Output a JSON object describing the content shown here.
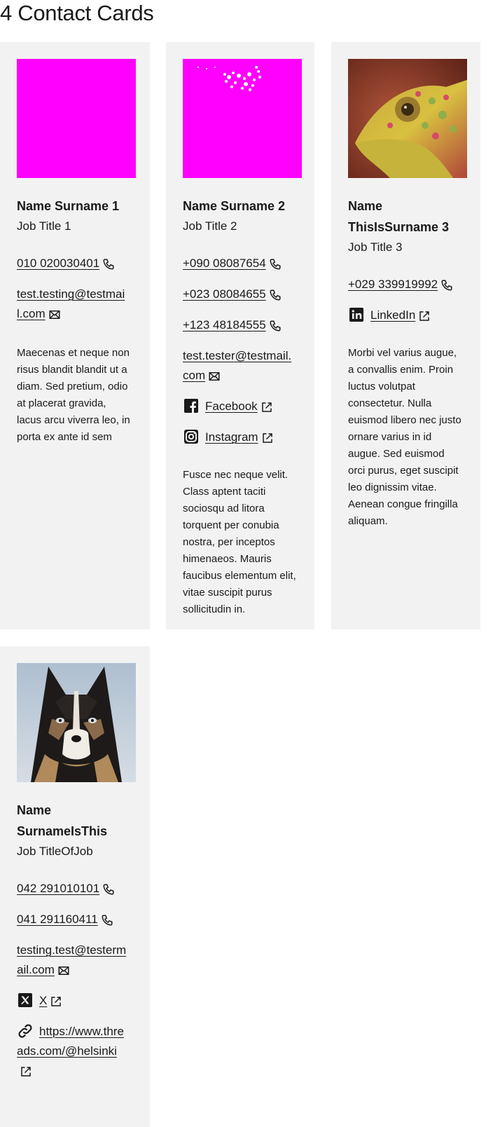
{
  "page": {
    "title": "4 Contact Cards"
  },
  "cards": [
    {
      "name": "Name Surname 1",
      "job": "Job Title 1",
      "phones": [
        "010 020030401"
      ],
      "email": [
        "test.testing@testmai",
        "l.com"
      ],
      "description": "Maecenas et neque non risus blandit blandit ut a diam. Sed pretium, odio at placerat gravida, lacus arcu viverra leo, in porta ex ante id sem",
      "photo_color": "#ff00ff"
    },
    {
      "name": "Name Surname 2",
      "job": "Job Title 2",
      "phones": [
        "+090 08087654",
        "+023 08084655",
        "+123 48184555"
      ],
      "email": [
        "test.tester@testmail.",
        "com"
      ],
      "facebook": "Facebook",
      "instagram": "Instagram",
      "description": "Fusce nec neque velit. Class aptent taciti sociosqu ad litora torquent per conubia nostra, per inceptos himenaeos. Mauris faucibus elementum elit, vitae suscipit purus sollicitudin in.",
      "photo_color": "#ff00ff"
    },
    {
      "name": "Name ThisIsSurname 3",
      "job": "Job Title 3",
      "phones": [
        "+029 339919992"
      ],
      "linkedin": "LinkedIn",
      "description": "Morbi vel varius augue, a convallis enim. Proin luctus volutpat consectetur. Nulla euismod libero nec justo ornare varius in id augue. Sed euismod orci purus, eget suscipit leo dignissim vitae. Aenean congue fringilla aliquam."
    },
    {
      "name": "Name SurnameIsThis",
      "job": "Job TitleOfJob",
      "phones": [
        "042 291010101",
        "041 291160411"
      ],
      "email": [
        "testing.test@testerm",
        "ail.com"
      ],
      "x": "X",
      "website": [
        "https://www.thre",
        "ads.com/@helsinki"
      ]
    }
  ],
  "icons": {
    "phone": "phone-icon",
    "email": "envelope-icon",
    "external": "external-link-icon",
    "facebook": "facebook-icon",
    "instagram": "instagram-icon",
    "linkedin": "linkedin-icon",
    "x": "x-icon",
    "link": "link-icon"
  },
  "colors": {
    "card_bg": "#f2f2f2",
    "text": "#1a1a1a",
    "placeholder": "#ff00ff"
  }
}
